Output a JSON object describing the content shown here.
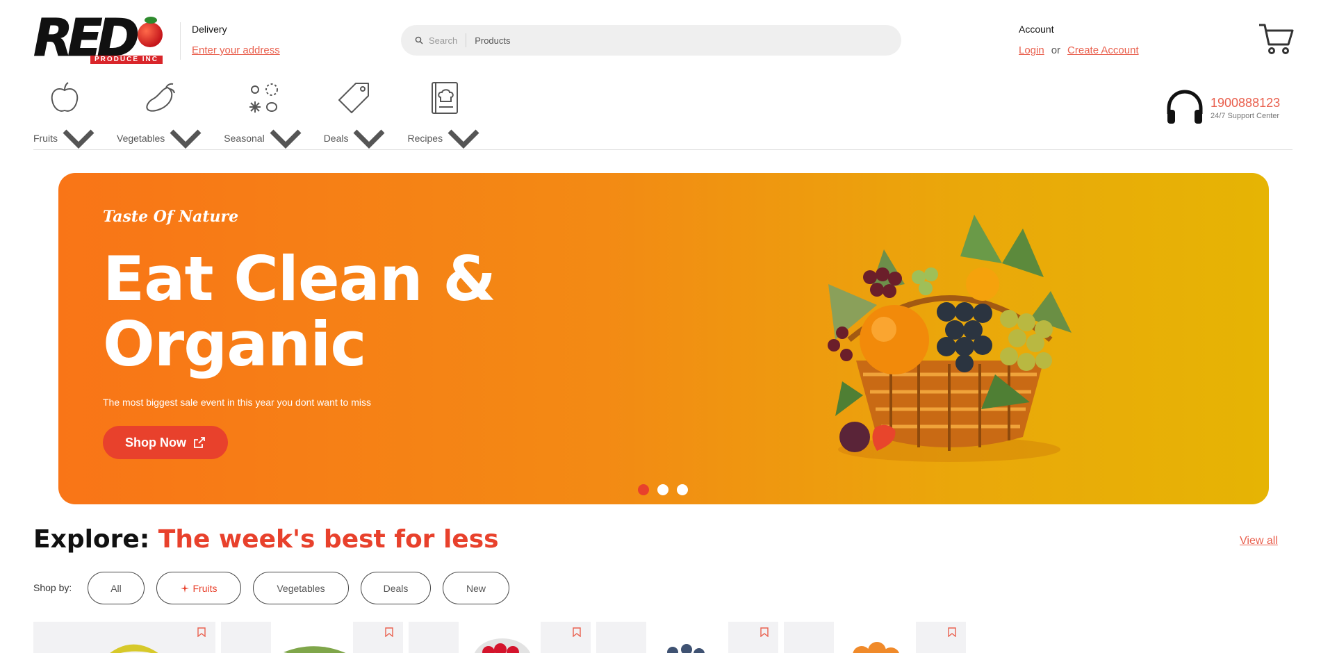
{
  "logo": {
    "text": "RED",
    "subtext": "PRODUCE INC",
    "colors": {
      "red": "#d9252a",
      "black": "#111111"
    }
  },
  "delivery": {
    "label": "Delivery",
    "link": "Enter your address"
  },
  "search": {
    "placeholder": "Search",
    "category": "Products"
  },
  "account": {
    "label": "Account",
    "login": "Login",
    "or": "or",
    "create": "Create Account"
  },
  "cart": {
    "icon": "cart-icon"
  },
  "categories": [
    {
      "label": "Fruits",
      "icon": "apple-icon"
    },
    {
      "label": "Vegetables",
      "icon": "eggplant-icon"
    },
    {
      "label": "Seasonal",
      "icon": "seasons-icon"
    },
    {
      "label": "Deals",
      "icon": "tag-icon"
    },
    {
      "label": "Recipes",
      "icon": "recipe-book-icon"
    }
  ],
  "support": {
    "phone": "1900888123",
    "subtitle": "24/7 Support Center",
    "icon": "headphones-icon"
  },
  "hero": {
    "tagline": "Taste Of Nature",
    "title": "Eat Clean & Organic",
    "description": "The most biggest sale event in this year you dont want to miss",
    "button": "Shop Now",
    "image": "fruit-basket-image",
    "slides": 3,
    "active_slide": 1
  },
  "explore": {
    "prefix": "Explore:",
    "title": "The week's best for less",
    "view_all": "View all"
  },
  "shop_by": {
    "label": "Shop by:",
    "filters": [
      "All",
      "Fruits",
      "Vegetables",
      "Deals",
      "New"
    ],
    "active": "Fruits"
  },
  "products": [
    {
      "name": "bananas",
      "icon": "bookmark-icon"
    },
    {
      "name": "green plantains",
      "icon": "bookmark-icon"
    },
    {
      "name": "raspberries",
      "icon": "bookmark-icon"
    },
    {
      "name": "blueberries",
      "icon": "bookmark-icon"
    },
    {
      "name": "apricots",
      "icon": "bookmark-icon"
    }
  ],
  "colors": {
    "accent": "#e8412c",
    "link": "#e9604e",
    "hero_start": "#f97517",
    "hero_end": "#e6b404"
  }
}
